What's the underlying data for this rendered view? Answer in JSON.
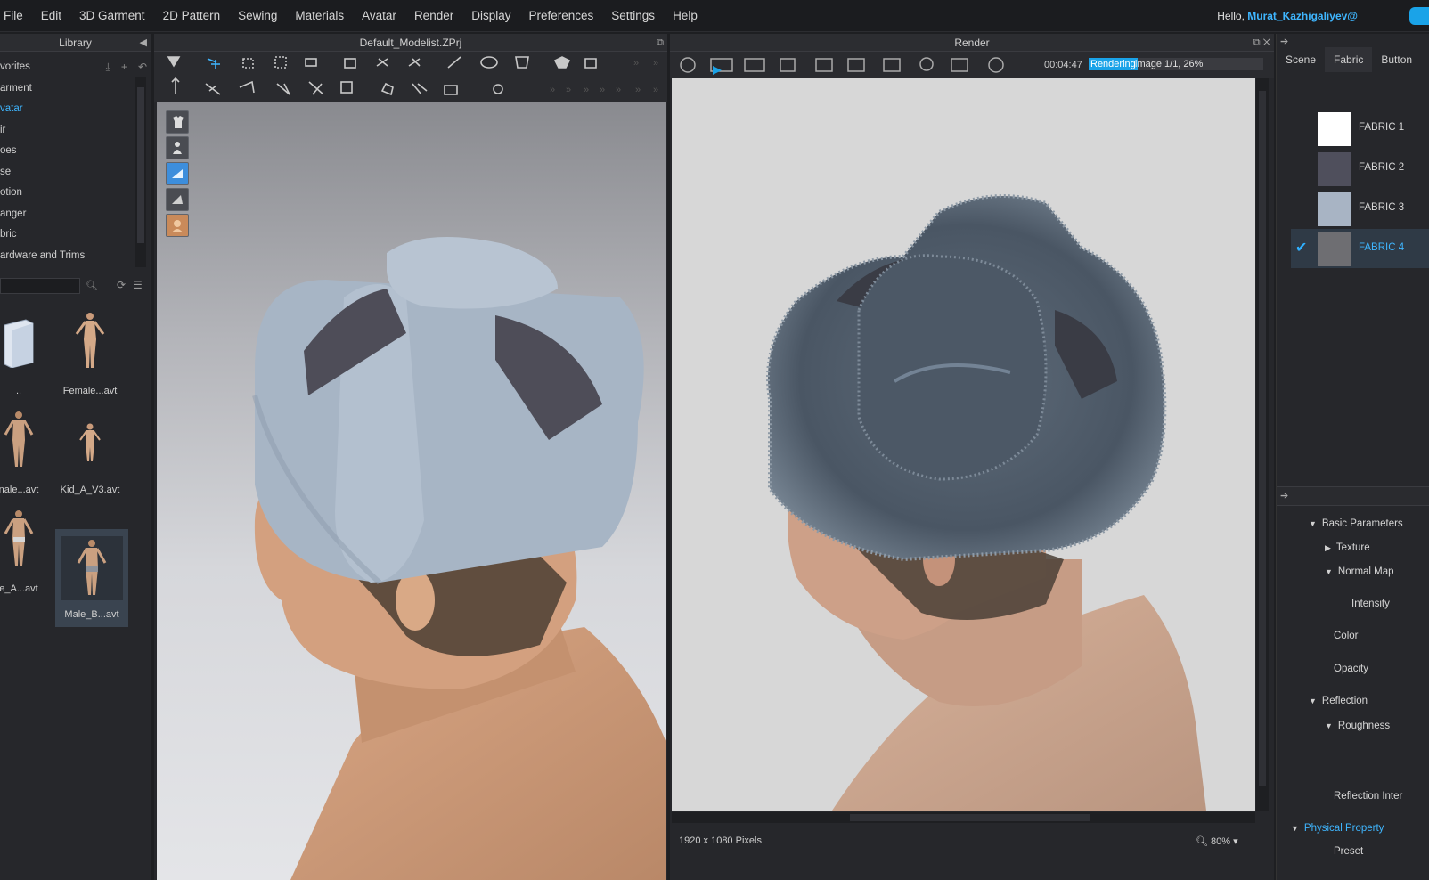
{
  "menubar": {
    "items": [
      "File",
      "Edit",
      "3D Garment",
      "2D Pattern",
      "Sewing",
      "Materials",
      "Avatar",
      "Render",
      "Display",
      "Preferences",
      "Settings",
      "Help"
    ],
    "greeting": "Hello, ",
    "username": "Murat_Kazhigaliyev@"
  },
  "library": {
    "title": "Library",
    "tree": [
      "vorites",
      "arment",
      "vatar",
      "ir",
      "oes",
      "se",
      "otion",
      "anger",
      "bric",
      "ardware and Trims"
    ],
    "active_index": 2,
    "thumbnails": [
      {
        "label": ".."
      },
      {
        "label": "Female...avt"
      },
      {
        "label": "nale...avt"
      },
      {
        "label": "Kid_A_V3.avt"
      },
      {
        "label": "e_A...avt"
      },
      {
        "label": "Male_B...avt"
      }
    ]
  },
  "view3d": {
    "title": "Default_Modelist.ZPrj"
  },
  "render": {
    "title": "Render",
    "time": "00:04:47",
    "status": "Rendering",
    "detail": "image 1/1, 26%",
    "progress": 0.26,
    "resolution": "1920 x 1080 Pixels",
    "zoom": "80%"
  },
  "rightpanel": {
    "tabs": [
      "Scene",
      "Fabric",
      "Button"
    ],
    "active_tab": 1,
    "fabrics": [
      {
        "label": "FABRIC 1",
        "color": "#ffffff"
      },
      {
        "label": "FABRIC 2",
        "color": "#4f4f5c"
      },
      {
        "label": "FABRIC 3",
        "color": "#a8b4c4"
      },
      {
        "label": "FABRIC 4",
        "color": "#6e6e72"
      }
    ],
    "selected_fabric": 3,
    "properties": {
      "basic": "Basic Parameters",
      "texture": "Texture",
      "normal_map": "Normal Map",
      "intensity": "Intensity",
      "color": "Color",
      "opacity": "Opacity",
      "reflection": "Reflection",
      "roughness": "Roughness",
      "reflection_inter": "Reflection Inter",
      "physical": "Physical Property",
      "preset": "Preset"
    }
  },
  "colors": {
    "accent": "#1aa3e8",
    "link": "#3fb6ff"
  }
}
